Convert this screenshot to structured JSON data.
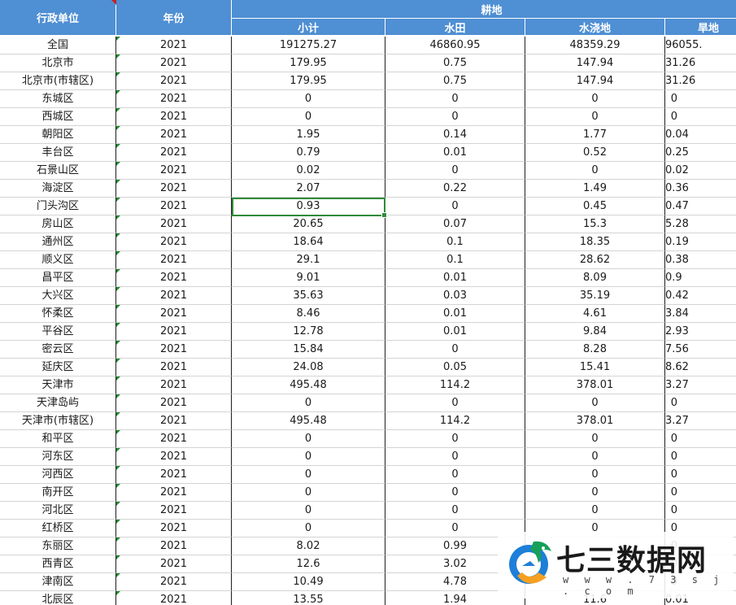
{
  "headers": {
    "region": "行政单位",
    "year": "年份",
    "group": "耕地",
    "subtotal": "小计",
    "paddy": "水田",
    "irrigated": "水浇地",
    "dry": "旱地"
  },
  "rows": [
    [
      "全国",
      "2021",
      "191275.27",
      "46860.95",
      "48359.29",
      "96055."
    ],
    [
      "北京市",
      "2021",
      "179.95",
      "0.75",
      "147.94",
      "31.26"
    ],
    [
      "北京市(市辖区)",
      "2021",
      "179.95",
      "0.75",
      "147.94",
      "31.26"
    ],
    [
      "东城区",
      "2021",
      "0",
      "0",
      "0",
      "0"
    ],
    [
      "西城区",
      "2021",
      "0",
      "0",
      "0",
      "0"
    ],
    [
      "朝阳区",
      "2021",
      "1.95",
      "0.14",
      "1.77",
      "0.04"
    ],
    [
      "丰台区",
      "2021",
      "0.79",
      "0.01",
      "0.52",
      "0.25"
    ],
    [
      "石景山区",
      "2021",
      "0.02",
      "0",
      "0",
      "0.02"
    ],
    [
      "海淀区",
      "2021",
      "2.07",
      "0.22",
      "1.49",
      "0.36"
    ],
    [
      "门头沟区",
      "2021",
      "0.93",
      "0",
      "0.45",
      "0.47"
    ],
    [
      "房山区",
      "2021",
      "20.65",
      "0.07",
      "15.3",
      "5.28"
    ],
    [
      "通州区",
      "2021",
      "18.64",
      "0.1",
      "18.35",
      "0.19"
    ],
    [
      "顺义区",
      "2021",
      "29.1",
      "0.1",
      "28.62",
      "0.38"
    ],
    [
      "昌平区",
      "2021",
      "9.01",
      "0.01",
      "8.09",
      "0.9"
    ],
    [
      "大兴区",
      "2021",
      "35.63",
      "0.03",
      "35.19",
      "0.42"
    ],
    [
      "怀柔区",
      "2021",
      "8.46",
      "0.01",
      "4.61",
      "3.84"
    ],
    [
      "平谷区",
      "2021",
      "12.78",
      "0.01",
      "9.84",
      "2.93"
    ],
    [
      "密云区",
      "2021",
      "15.84",
      "0",
      "8.28",
      "7.56"
    ],
    [
      "延庆区",
      "2021",
      "24.08",
      "0.05",
      "15.41",
      "8.62"
    ],
    [
      "天津市",
      "2021",
      "495.48",
      "114.2",
      "378.01",
      "3.27"
    ],
    [
      "天津岛屿",
      "2021",
      "0",
      "0",
      "0",
      "0"
    ],
    [
      "天津市(市辖区)",
      "2021",
      "495.48",
      "114.2",
      "378.01",
      "3.27"
    ],
    [
      "和平区",
      "2021",
      "0",
      "0",
      "0",
      "0"
    ],
    [
      "河东区",
      "2021",
      "0",
      "0",
      "0",
      "0"
    ],
    [
      "河西区",
      "2021",
      "0",
      "0",
      "0",
      "0"
    ],
    [
      "南开区",
      "2021",
      "0",
      "0",
      "0",
      "0"
    ],
    [
      "河北区",
      "2021",
      "0",
      "0",
      "0",
      "0"
    ],
    [
      "红桥区",
      "2021",
      "0",
      "0",
      "0",
      "0"
    ],
    [
      "东丽区",
      "2021",
      "8.02",
      "0.99",
      "",
      "0"
    ],
    [
      "西青区",
      "2021",
      "12.6",
      "3.02",
      "",
      "0"
    ],
    [
      "津南区",
      "2021",
      "10.49",
      "4.78",
      "",
      "0"
    ],
    [
      "北辰区",
      "2021",
      "13.55",
      "1.94",
      "11.6",
      "0.01"
    ]
  ],
  "selected_cell": "0.93",
  "watermark": {
    "title": "七三数据网",
    "url": "w w w . 7 3 s j . c o m"
  },
  "colors": {
    "header_bg": "#4f8fd3",
    "selection": "#2e8b3a",
    "triangle": "#1e8a2e"
  }
}
